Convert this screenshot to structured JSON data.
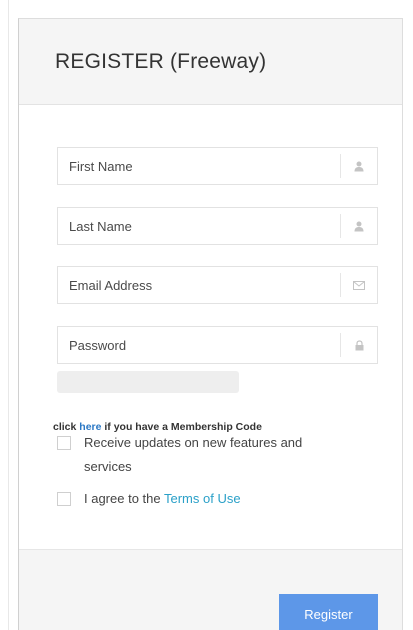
{
  "header": {
    "title": "REGISTER (Freeway)"
  },
  "form": {
    "first_name": {
      "placeholder": "First Name",
      "value": "",
      "icon": "user-icon"
    },
    "last_name": {
      "placeholder": "Last Name",
      "value": "",
      "icon": "user-icon"
    },
    "email": {
      "placeholder": "Email Address",
      "value": "",
      "icon": "envelope-icon"
    },
    "password": {
      "placeholder": "Password",
      "value": "",
      "icon": "lock-icon"
    },
    "password_strength": 0
  },
  "membership": {
    "prefix": "click ",
    "link": "here",
    "suffix": " if you have a Membership Code"
  },
  "checkboxes": {
    "updates_label": "Receive updates on new features and services",
    "terms_prefix": "I agree to the ",
    "terms_link": "Terms of Use"
  },
  "footer": {
    "register_label": "Register"
  },
  "colors": {
    "button": "#5d97e8",
    "link": "#2b78c5",
    "terms_link": "#2aa0c8",
    "header_bg": "#f5f5f5"
  }
}
